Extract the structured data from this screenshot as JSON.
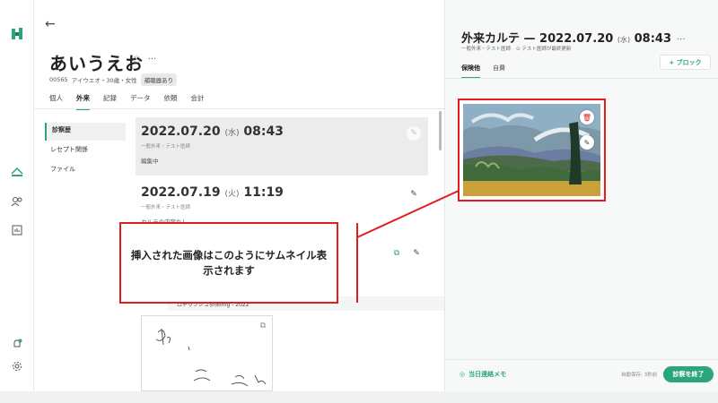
{
  "colors": {
    "accent": "#2ba57a",
    "callout": "#e01d1d",
    "selected_row": "#ececec"
  },
  "rail": {
    "logo_icon": "app-logo-icon",
    "items": [
      "home-icon",
      "users-icon",
      "chart-icon"
    ],
    "bottom": [
      "bell-icon",
      "gear-icon"
    ]
  },
  "patient": {
    "back_icon": "arrow-left-icon",
    "name": "あいうえお",
    "id": "00565",
    "kana_age_sex": "アイウエオ・30歳・女性",
    "badge": "補聴器あり",
    "tabs": [
      {
        "label": "個人"
      },
      {
        "label": "外来"
      },
      {
        "label": "記録"
      },
      {
        "label": "データ"
      },
      {
        "label": "依頼"
      },
      {
        "label": "会計"
      }
    ],
    "active_tab": 1
  },
  "subnav": {
    "items": [
      {
        "label": "診察歴"
      },
      {
        "label": "レセプト関係"
      },
      {
        "label": "ファイル"
      }
    ]
  },
  "records": [
    {
      "date": "2022.07.20",
      "dow": "(水)",
      "time": "08:43",
      "sub": "一般外来・テスト医師",
      "note": "編集中"
    },
    {
      "date": "2022.07.19",
      "dow": "(火)",
      "time": "11:19",
      "sub": "一般外来・テスト医師",
      "note": "カルテの内容なし"
    }
  ],
  "attachment": {
    "filename": "ロチックシュ参照img - 2022"
  },
  "callout": {
    "text": "挿入された画像はこのようにサムネイル表示されます"
  },
  "karte": {
    "title": "外来カルテ — 2022.07.20",
    "dow": "(水)",
    "time": "08:43",
    "more": "···",
    "dept": "一般外来・テスト医師",
    "updated": "テスト医師が最終更新",
    "tabs": [
      {
        "label": "保険他"
      },
      {
        "label": "自費"
      }
    ],
    "block_button": "+ ブロック"
  },
  "footer": {
    "memo": "当日連絡メモ",
    "autosave": "自動保存: 3秒前",
    "end_button": "診察を終了"
  }
}
